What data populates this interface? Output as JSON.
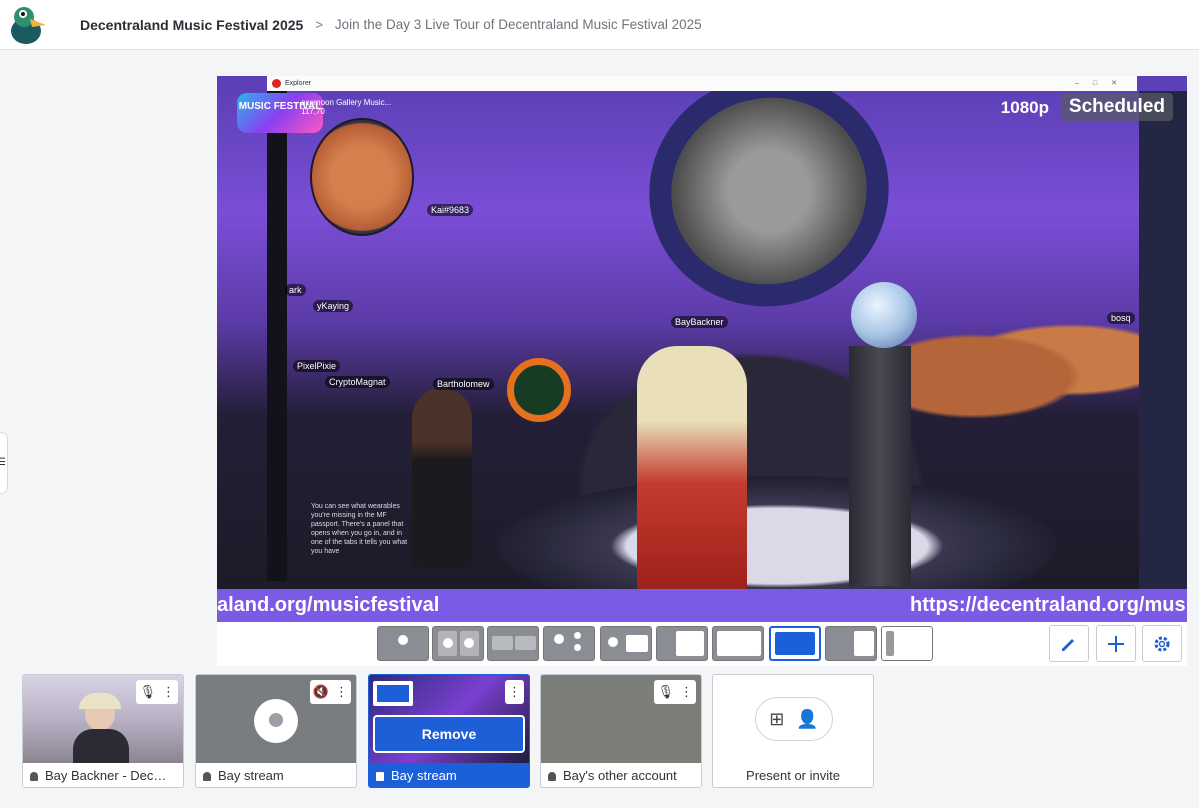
{
  "header": {
    "event_title": "Decentraland Music Festival 2025",
    "separator": ">",
    "page_subtitle": "Join the Day 3 Live Tour of Decentraland Music Festival 2025"
  },
  "stage": {
    "window_title": "Explorer",
    "quality": "1080p",
    "status": "Scheduled",
    "url_left": "aland.org/musicfestival",
    "url_right": "https://decentraland.org/musi",
    "location_label": "acemoon Gallery Music...",
    "coords": "117,70",
    "logo_text": "MUSIC FESTIVAL",
    "avatar_tags": [
      "Kai#9683",
      "BayBackner",
      "PixelPixie",
      "CryptoMagnat",
      "Bartholomew",
      "yKaying",
      "bosq",
      "ark"
    ],
    "chat_text": "You can see what wearables you're missing in the MF passport. There's a panel that opens when you go in, and in one of the tabs it tells you what you have"
  },
  "layout_options": [
    {
      "name": "single-speaker",
      "selected": false
    },
    {
      "name": "two-side",
      "selected": false
    },
    {
      "name": "two-small",
      "selected": false
    },
    {
      "name": "three-mixed",
      "selected": false
    },
    {
      "name": "speaker-screen",
      "selected": false
    },
    {
      "name": "list-screen",
      "selected": false
    },
    {
      "name": "screen-caption",
      "selected": false
    },
    {
      "name": "full-screen",
      "selected": true
    },
    {
      "name": "speaker-side-screen",
      "selected": false
    },
    {
      "name": "list-side-screen",
      "selected": false
    }
  ],
  "actions": {
    "edit_icon": "pencil-icon",
    "add_icon": "plus-icon",
    "settings_icon": "gear-icon"
  },
  "participants": [
    {
      "name": "Bay Backner - Dec…",
      "mic": "on",
      "active": false,
      "has_video": true
    },
    {
      "name": "Bay stream",
      "mic": "muted",
      "active": false,
      "has_video": false
    },
    {
      "name": "Bay stream",
      "mic": "none",
      "active": true,
      "remove_label": "Remove"
    },
    {
      "name": "Bay's other account",
      "mic": "on",
      "active": false,
      "has_video": false
    }
  ],
  "present_tile": {
    "label": "Present or invite"
  },
  "colors": {
    "accent": "#1b5fd9",
    "banner": "#7b5ae6"
  }
}
